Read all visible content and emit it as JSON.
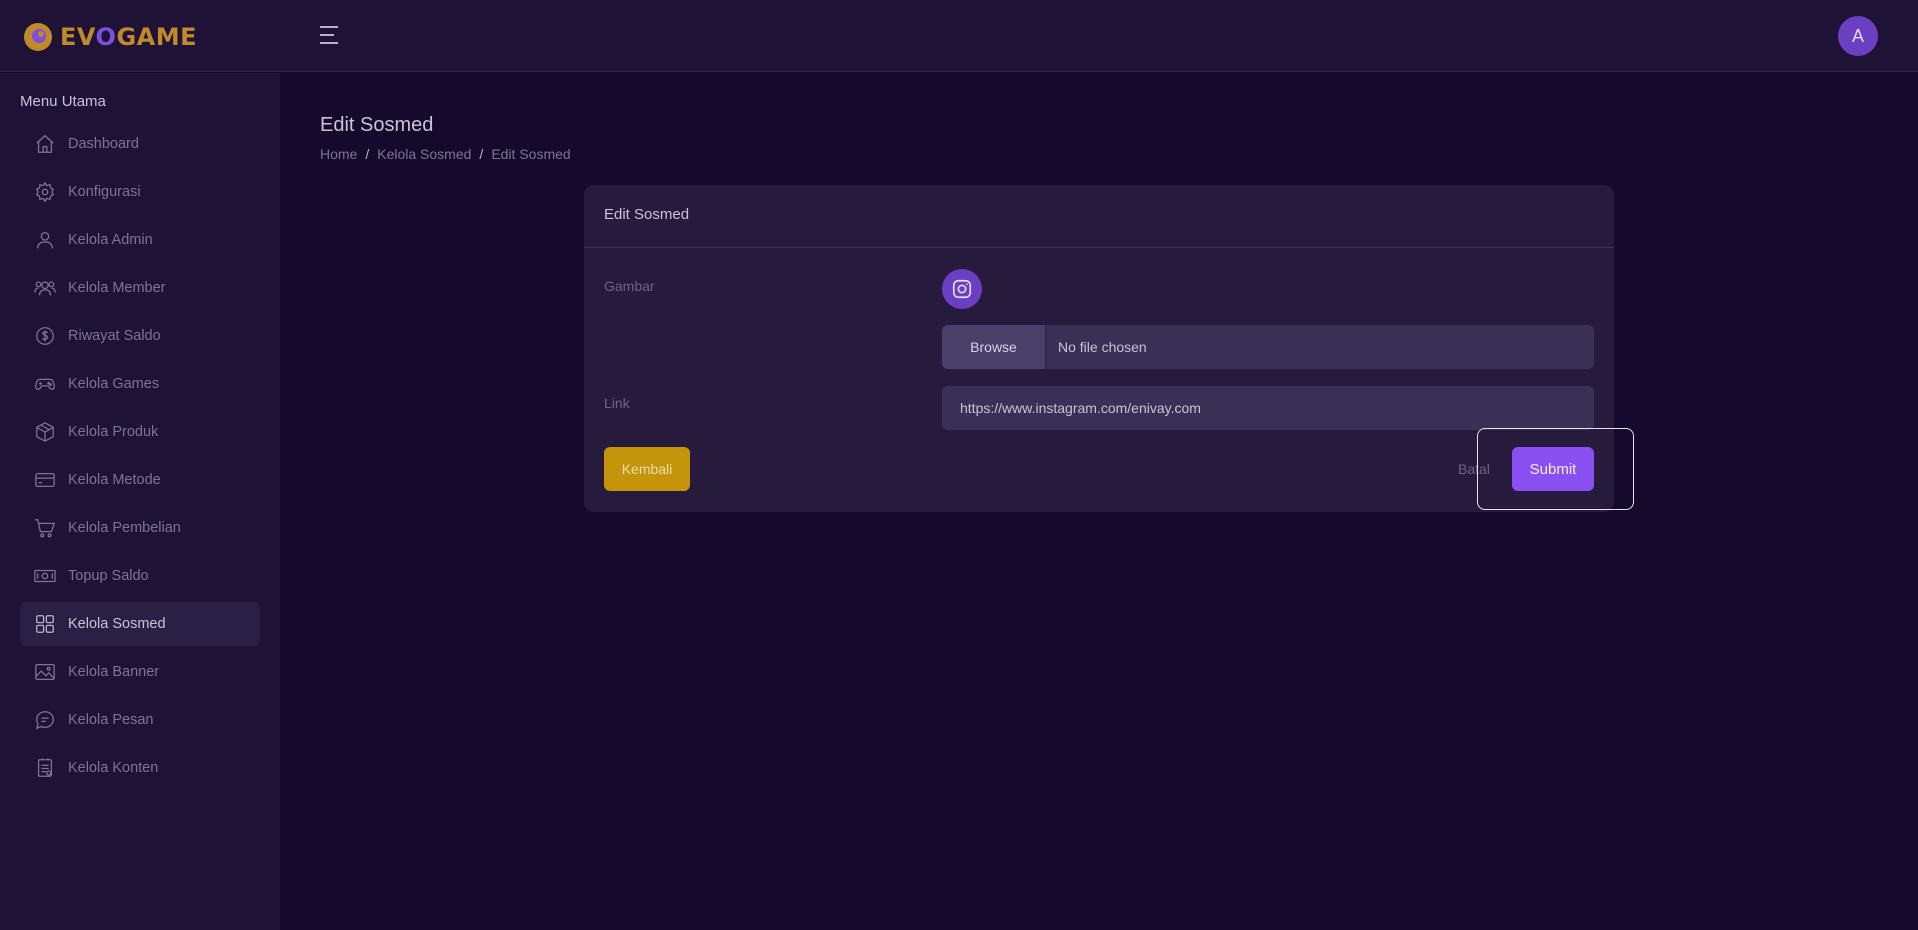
{
  "header": {
    "logo_text_a": "EV",
    "logo_text_b": "O",
    "logo_text_c": "GAME",
    "avatar_initial": "A"
  },
  "sidebar": {
    "title": "Menu Utama",
    "items": [
      {
        "label": "Dashboard",
        "icon": "home-icon"
      },
      {
        "label": "Konfigurasi",
        "icon": "gear-icon"
      },
      {
        "label": "Kelola Admin",
        "icon": "user-icon"
      },
      {
        "label": "Kelola Member",
        "icon": "users-icon"
      },
      {
        "label": "Riwayat Saldo",
        "icon": "dollar-icon"
      },
      {
        "label": "Kelola Games",
        "icon": "gamepad-icon"
      },
      {
        "label": "Kelola Produk",
        "icon": "box-icon"
      },
      {
        "label": "Kelola Metode",
        "icon": "card-icon"
      },
      {
        "label": "Kelola Pembelian",
        "icon": "cart-icon"
      },
      {
        "label": "Topup Saldo",
        "icon": "cash-icon"
      },
      {
        "label": "Kelola Sosmed",
        "icon": "grid-icon"
      },
      {
        "label": "Kelola Banner",
        "icon": "image-icon"
      },
      {
        "label": "Kelola Pesan",
        "icon": "chat-icon"
      },
      {
        "label": "Kelola Konten",
        "icon": "file-icon"
      }
    ],
    "active_item": "Kelola Sosmed"
  },
  "page": {
    "title": "Edit Sosmed",
    "breadcrumb": [
      "Home",
      "Kelola Sosmed",
      "Edit Sosmed"
    ]
  },
  "form": {
    "card_title": "Edit Sosmed",
    "gambar_label": "Gambar",
    "current_icon": "instagram-icon",
    "browse_label": "Browse",
    "file_status": "No file chosen",
    "link_label": "Link",
    "link_value": "https://www.instagram.com/enivay.com",
    "back_label": "Kembali",
    "cancel_label": "Batal",
    "submit_label": "Submit"
  },
  "colors": {
    "background": "#150a2b",
    "panel": "#1e1236",
    "accent": "#8a4ff0",
    "warning": "#c4950a"
  }
}
